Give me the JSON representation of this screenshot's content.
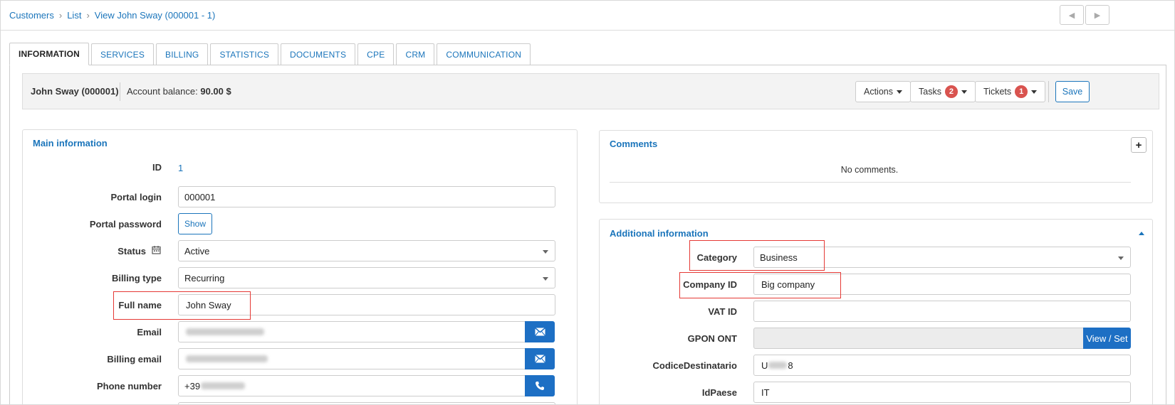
{
  "breadcrumb": {
    "items": [
      "Customers",
      "List",
      "View John Sway (000001 - 1)"
    ]
  },
  "nav": {
    "prev": "◀",
    "next": "▶"
  },
  "tabs": [
    "INFORMATION",
    "SERVICES",
    "BILLING",
    "STATISTICS",
    "DOCUMENTS",
    "CPE",
    "CRM",
    "COMMUNICATION"
  ],
  "header": {
    "customer_name": "John Sway (000001)",
    "balance_label": "Account balance:",
    "balance_value": "90.00 $",
    "actions_label": "Actions",
    "tasks_label": "Tasks",
    "tasks_count": "2",
    "tickets_label": "Tickets",
    "tickets_count": "1",
    "save_label": "Save"
  },
  "main_info": {
    "title": "Main information",
    "id_label": "ID",
    "id_value": "1",
    "portal_login_label": "Portal login",
    "portal_login_value": "000001",
    "portal_password_label": "Portal password",
    "show_label": "Show",
    "status_label": "Status",
    "status_value": "Active",
    "billing_type_label": "Billing type",
    "billing_type_value": "Recurring",
    "full_name_label": "Full name",
    "full_name_value": "John Sway",
    "email_label": "Email",
    "billing_email_label": "Billing email",
    "phone_label": "Phone number",
    "phone_prefix": "+39"
  },
  "comments": {
    "title": "Comments",
    "add_label": "+",
    "empty_text": "No comments."
  },
  "additional_info": {
    "title": "Additional information",
    "category_label": "Category",
    "category_value": "Business",
    "company_id_label": "Company ID",
    "company_id_value": "Big company",
    "vat_id_label": "VAT ID",
    "vat_id_value": "",
    "gpon_label": "GPON ONT",
    "view_set_label": "View / Set",
    "codice_label": "CodiceDestinatario",
    "codice_prefix": "U",
    "codice_suffix": "8",
    "idpaese_label": "IdPaese",
    "idpaese_value": "IT"
  },
  "colors": {
    "link": "#1b75bb",
    "primary_button": "#1d6fc4",
    "badge": "#d9534f",
    "highlight": "#e53935"
  }
}
